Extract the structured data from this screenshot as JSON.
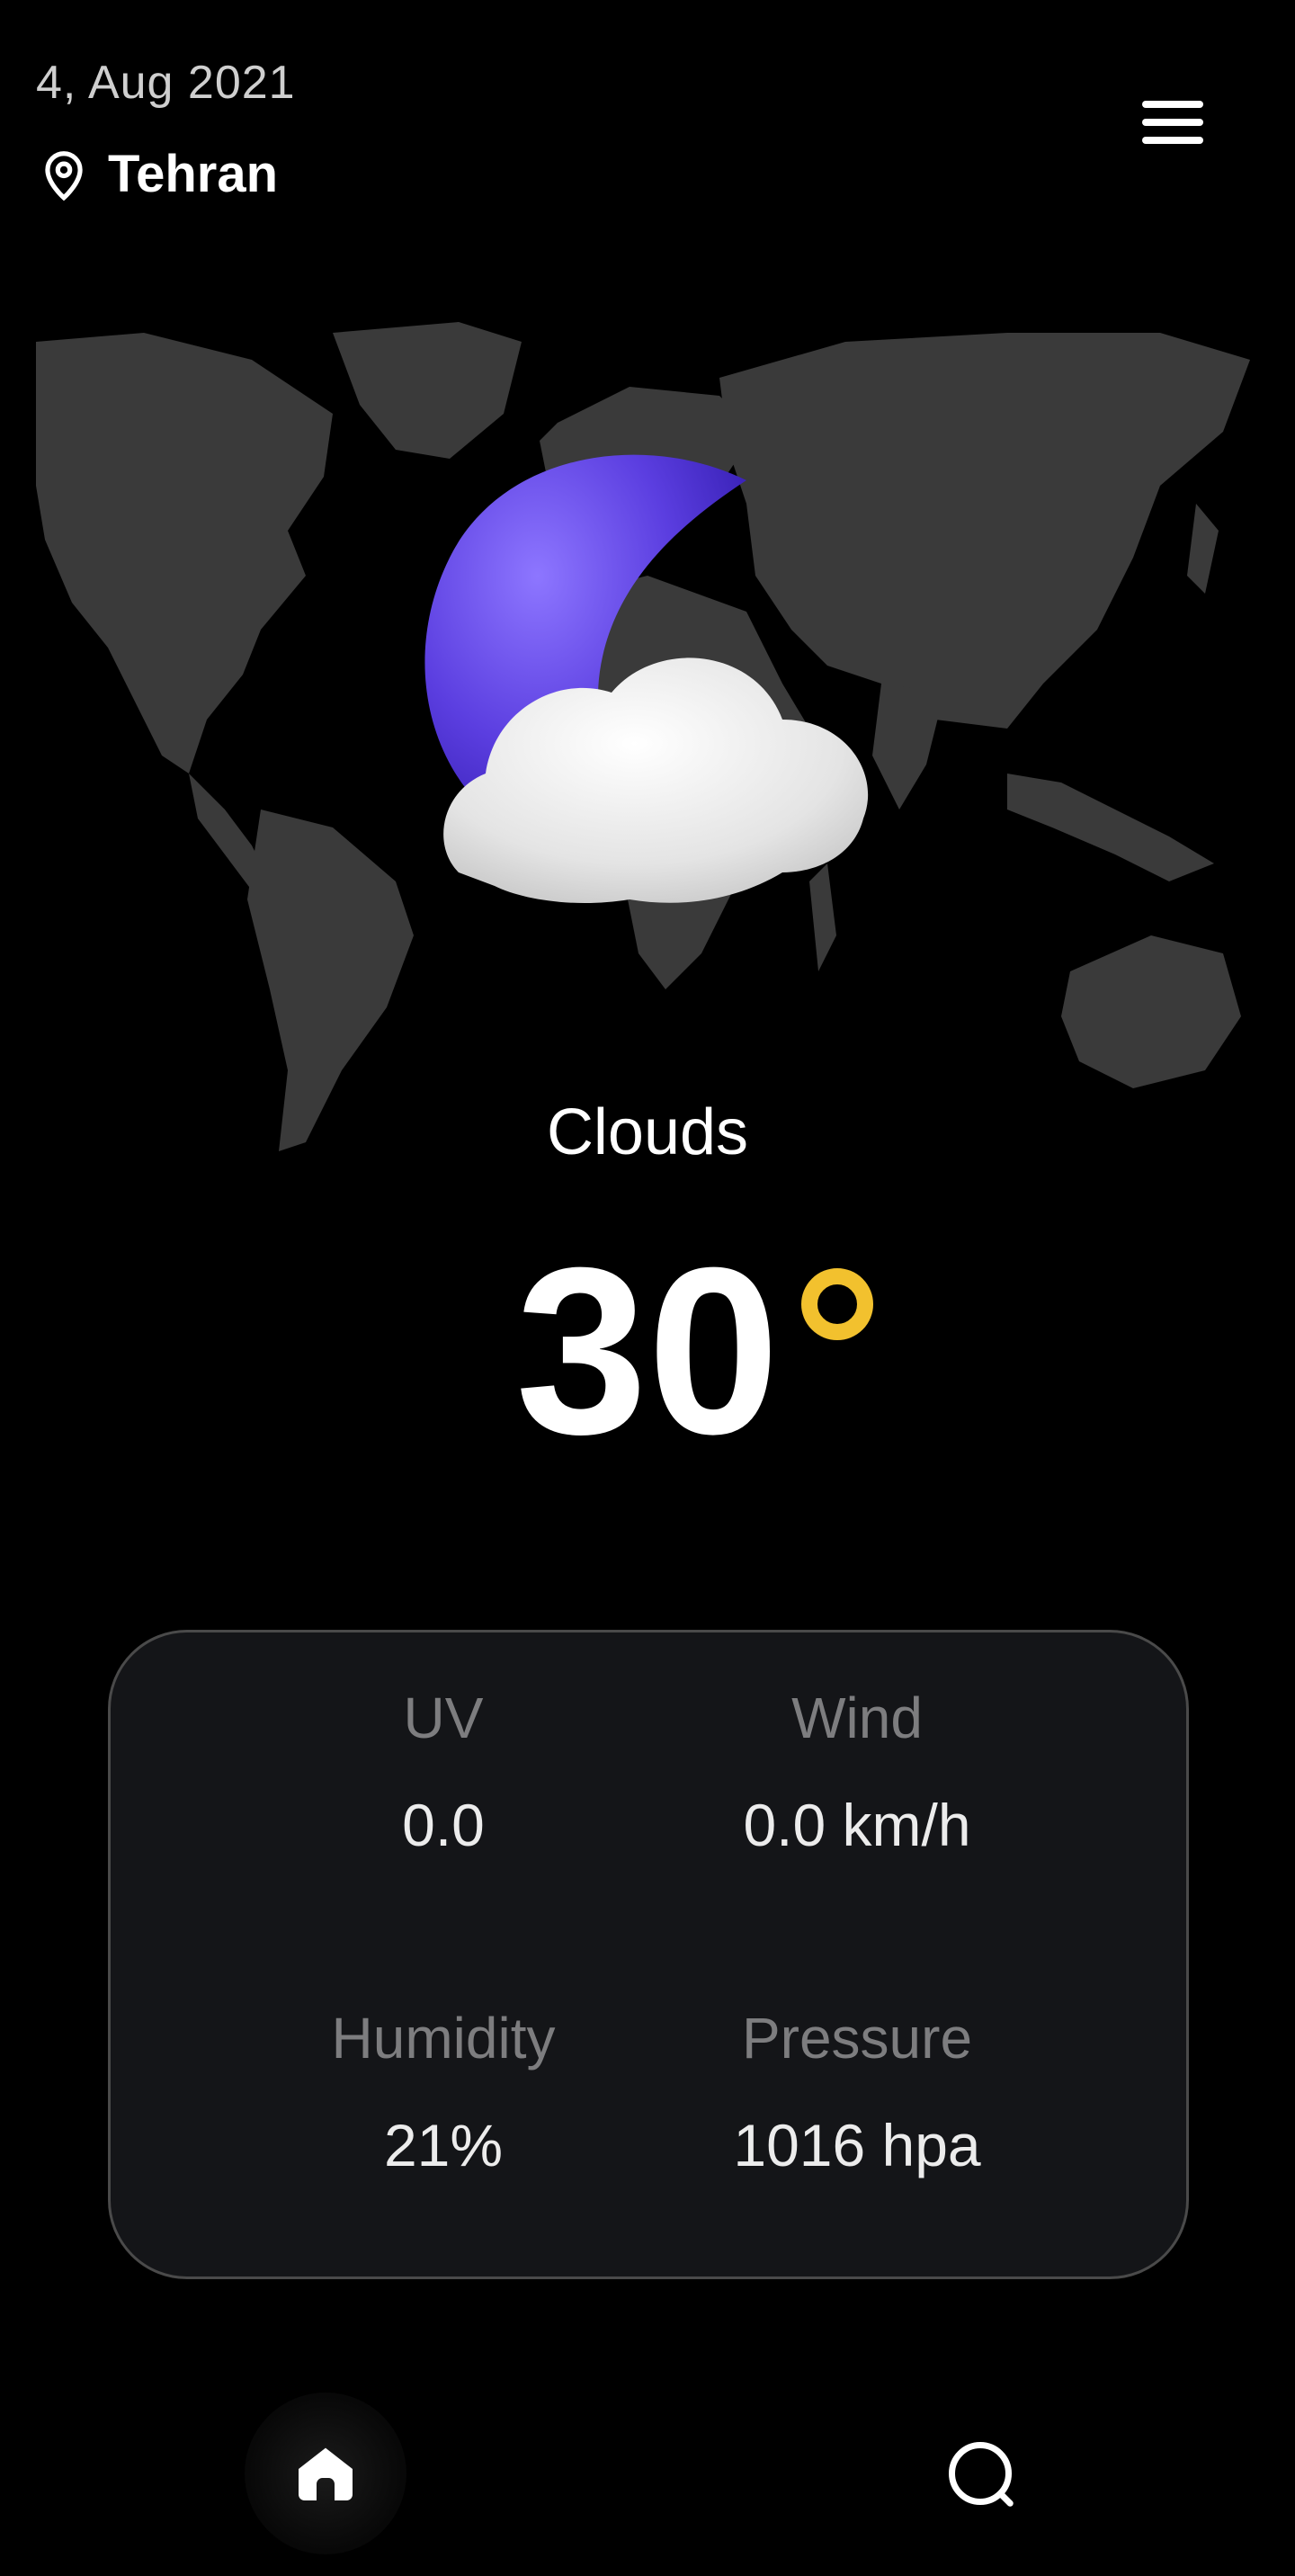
{
  "header": {
    "date": "4,  Aug 2021",
    "city": "Tehran",
    "icons": {
      "location": "map-pin-icon",
      "menu": "hamburger-menu-icon"
    }
  },
  "weather": {
    "condition": "Clouds",
    "temperature": "30",
    "icon": "moon-cloud-icon"
  },
  "stats": {
    "uv": {
      "label": "UV",
      "value": "0.0"
    },
    "wind": {
      "label": "Wind",
      "value": "0.0 km/h"
    },
    "humidity": {
      "label": "Humidity",
      "value": "21%"
    },
    "pressure": {
      "label": "Pressure",
      "value": "1016 hpa"
    }
  },
  "nav": {
    "items": [
      {
        "icon": "home-icon",
        "active": true
      },
      {
        "icon": "search-icon",
        "active": false
      }
    ]
  },
  "colors": {
    "background": "#000000",
    "accent_degree": "#f2c12e",
    "moon": "#5b3ee0",
    "map": "#3a3a3a",
    "card": "#141518"
  }
}
